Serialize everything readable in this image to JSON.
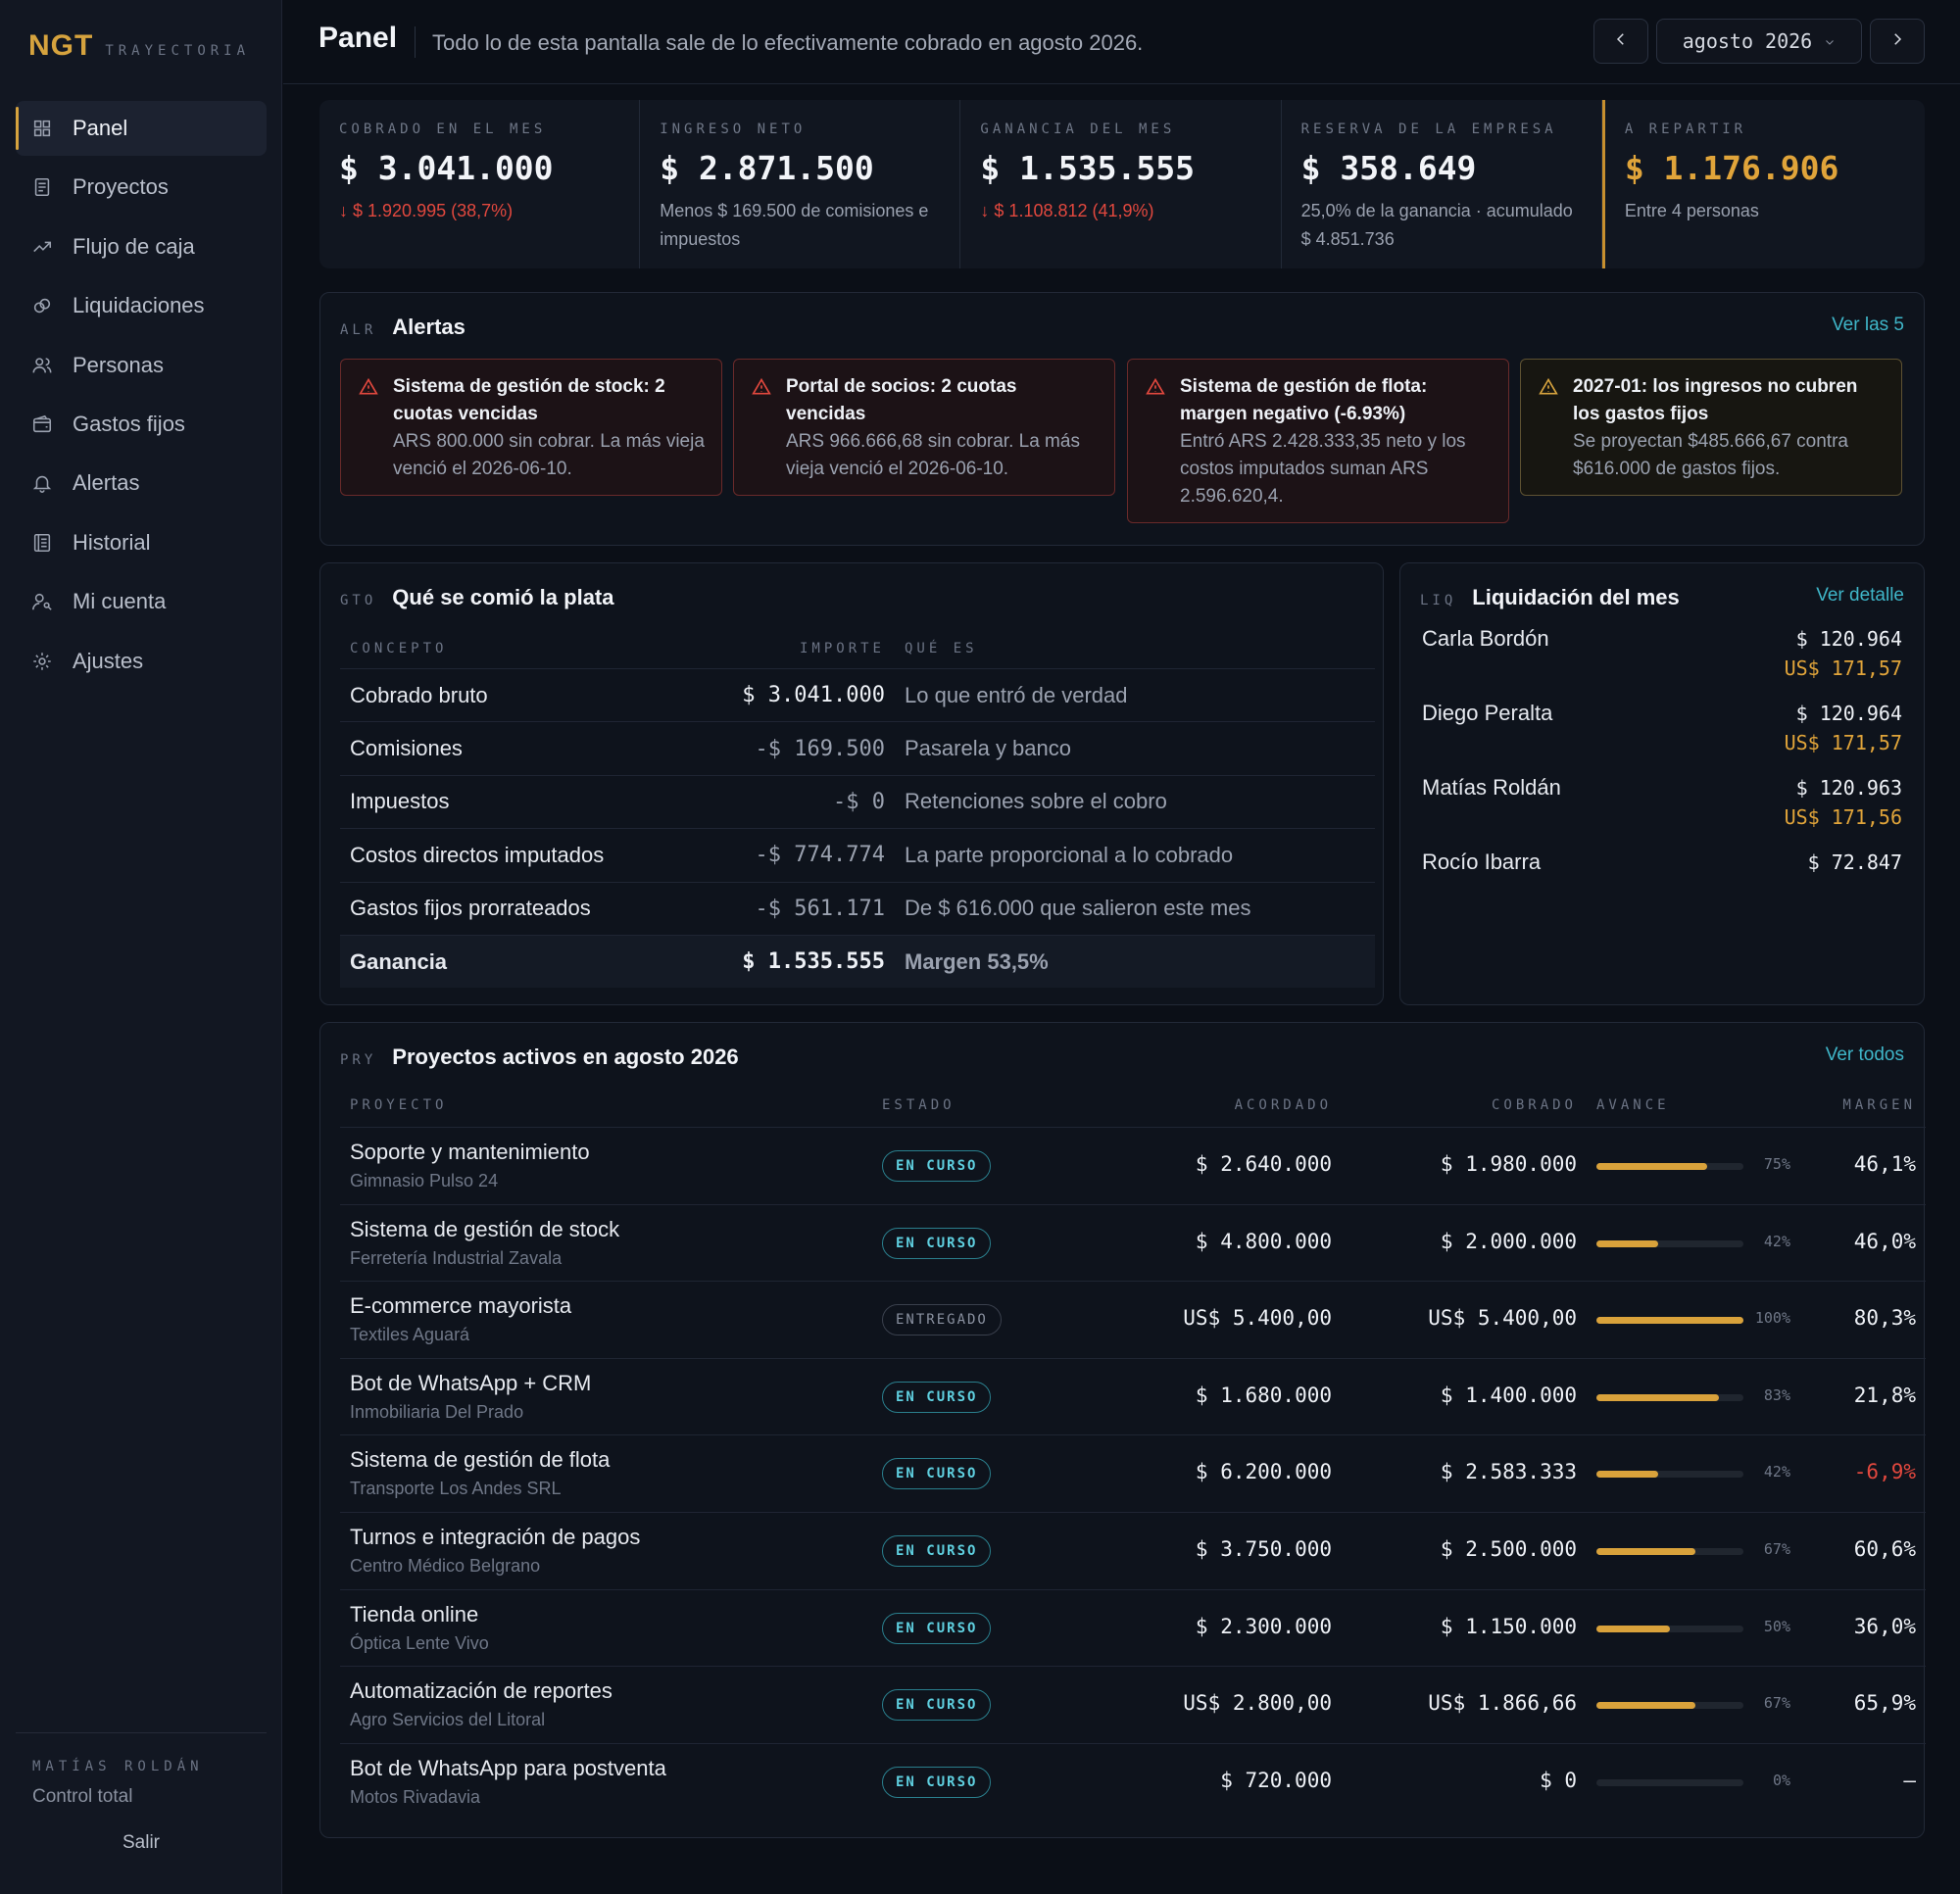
{
  "brand": {
    "logo": "NGT",
    "subtitle": "TRAYECTORIA"
  },
  "sidebar": {
    "items": [
      {
        "label": "Panel",
        "icon": "grid-icon",
        "active": true
      },
      {
        "label": "Proyectos",
        "icon": "document-icon"
      },
      {
        "label": "Flujo de caja",
        "icon": "trend-up-icon"
      },
      {
        "label": "Liquidaciones",
        "icon": "coins-icon"
      },
      {
        "label": "Personas",
        "icon": "users-icon"
      },
      {
        "label": "Gastos fijos",
        "icon": "wallet-icon"
      },
      {
        "label": "Alertas",
        "icon": "bell-icon"
      },
      {
        "label": "Historial",
        "icon": "ledger-icon"
      },
      {
        "label": "Mi cuenta",
        "icon": "user-key-icon"
      },
      {
        "label": "Ajustes",
        "icon": "gear-icon"
      }
    ],
    "user_name": "MATÍAS ROLDÁN",
    "user_role": "Control total",
    "logout": "Salir"
  },
  "header": {
    "title": "Panel",
    "subtitle": "Todo lo de esta pantalla sale de lo efectivamente cobrado en agosto 2026.",
    "month": "agosto 2026"
  },
  "kpis": [
    {
      "label": "COBRADO EN EL MES",
      "value": "$ 3.041.000",
      "note": "$ 1.920.995 (38,7%)",
      "note_type": "neg",
      "arrow": "↓"
    },
    {
      "label": "INGRESO NETO",
      "value": "$ 2.871.500",
      "note": "Menos $ 169.500 de comisiones e impuestos",
      "note_type": "muted"
    },
    {
      "label": "GANANCIA DEL MES",
      "value": "$ 1.535.555",
      "note": "$ 1.108.812 (41,9%)",
      "note_type": "neg",
      "arrow": "↓"
    },
    {
      "label": "RESERVA DE LA EMPRESA",
      "value": "$ 358.649",
      "note": "25,0% de la ganancia · acumulado $ 4.851.736",
      "note_type": "muted"
    },
    {
      "label": "A REPARTIR",
      "value": "$ 1.176.906",
      "note": "Entre 4 personas",
      "note_type": "muted",
      "highlight": true
    }
  ],
  "alerts": {
    "code": "ALR",
    "title": "Alertas",
    "link": "Ver las 5",
    "items": [
      {
        "title": "Sistema de gestión de stock: 2 cuotas vencidas",
        "body": "ARS 800.000 sin cobrar. La más vieja venció el 2026-06-10.",
        "level": "danger"
      },
      {
        "title": "Portal de socios: 2 cuotas vencidas",
        "body": "ARS 966.666,68 sin cobrar. La más vieja venció el 2026-06-10.",
        "level": "danger"
      },
      {
        "title": "Sistema de gestión de flota: margen negativo (-6.93%)",
        "body": "Entró ARS 2.428.333,35 neto y los costos imputados suman ARS 2.596.620,4.",
        "level": "danger"
      },
      {
        "title": "2027-01: los ingresos no cubren los gastos fijos",
        "body": "Se proyectan $485.666,67 contra $616.000 de gastos fijos.",
        "level": "warning"
      }
    ]
  },
  "gto": {
    "code": "GTO",
    "title": "Qué se comió la plata",
    "columns": {
      "concept": "CONCEPTO",
      "amount": "IMPORTE",
      "desc": "QUÉ ES"
    },
    "rows": [
      {
        "concept": "Cobrado bruto",
        "amount": "$ 3.041.000",
        "desc": "Lo que entró de verdad",
        "positive": true
      },
      {
        "concept": "Comisiones",
        "amount": "-$ 169.500",
        "desc": "Pasarela y banco"
      },
      {
        "concept": "Impuestos",
        "amount": "-$ 0",
        "desc": "Retenciones sobre el cobro"
      },
      {
        "concept": "Costos directos imputados",
        "amount": "-$ 774.774",
        "desc": "La parte proporcional a lo cobrado"
      },
      {
        "concept": "Gastos fijos prorrateados",
        "amount": "-$ 561.171",
        "desc": "De $ 616.000 que salieron este mes"
      },
      {
        "concept": "Ganancia",
        "amount": "$ 1.535.555",
        "desc": "Margen 53,5%",
        "positive": true,
        "total": true
      }
    ]
  },
  "liq": {
    "code": "LIQ",
    "title": "Liquidación del mes",
    "link": "Ver detalle",
    "rows": [
      {
        "name": "Carla Bordón",
        "ars": "$ 120.964",
        "usd": "US$ 171,57"
      },
      {
        "name": "Diego Peralta",
        "ars": "$ 120.964",
        "usd": "US$ 171,57"
      },
      {
        "name": "Matías Roldán",
        "ars": "$ 120.963",
        "usd": "US$ 171,56"
      },
      {
        "name": "Rocío Ibarra",
        "ars": "$ 72.847",
        "usd": ""
      }
    ]
  },
  "pry": {
    "code": "PRY",
    "title": "Proyectos activos en agosto 2026",
    "link": "Ver todos",
    "columns": {
      "project": "PROYECTO",
      "status": "ESTADO",
      "agreed": "ACORDADO",
      "paid": "COBRADO",
      "progress": "AVANCE",
      "margin": "MARGEN"
    },
    "rows": [
      {
        "name": "Soporte y mantenimiento",
        "client": "Gimnasio Pulso 24",
        "status": "EN CURSO",
        "agreed": "$ 2.640.000",
        "paid": "$ 1.980.000",
        "progress": 75,
        "progress_label": "75%",
        "margin": "46,1%"
      },
      {
        "name": "Sistema de gestión de stock",
        "client": "Ferretería Industrial Zavala",
        "status": "EN CURSO",
        "agreed": "$ 4.800.000",
        "paid": "$ 2.000.000",
        "progress": 42,
        "progress_label": "42%",
        "margin": "46,0%"
      },
      {
        "name": "E-commerce mayorista",
        "client": "Textiles Aguará",
        "status": "ENTREGADO",
        "agreed": "US$ 5.400,00",
        "paid": "US$ 5.400,00",
        "progress": 100,
        "progress_label": "100%",
        "margin": "80,3%"
      },
      {
        "name": "Bot de WhatsApp + CRM",
        "client": "Inmobiliaria Del Prado",
        "status": "EN CURSO",
        "agreed": "$ 1.680.000",
        "paid": "$ 1.400.000",
        "progress": 83,
        "progress_label": "83%",
        "margin": "21,8%"
      },
      {
        "name": "Sistema de gestión de flota",
        "client": "Transporte Los Andes SRL",
        "status": "EN CURSO",
        "agreed": "$ 6.200.000",
        "paid": "$ 2.583.333",
        "progress": 42,
        "progress_label": "42%",
        "margin": "-6,9%",
        "margin_negative": true
      },
      {
        "name": "Turnos e integración de pagos",
        "client": "Centro Médico Belgrano",
        "status": "EN CURSO",
        "agreed": "$ 3.750.000",
        "paid": "$ 2.500.000",
        "progress": 67,
        "progress_label": "67%",
        "margin": "60,6%"
      },
      {
        "name": "Tienda online",
        "client": "Óptica Lente Vivo",
        "status": "EN CURSO",
        "agreed": "$ 2.300.000",
        "paid": "$ 1.150.000",
        "progress": 50,
        "progress_label": "50%",
        "margin": "36,0%"
      },
      {
        "name": "Automatización de reportes",
        "client": "Agro Servicios del Litoral",
        "status": "EN CURSO",
        "agreed": "US$ 2.800,00",
        "paid": "US$ 1.866,66",
        "progress": 67,
        "progress_label": "67%",
        "margin": "65,9%"
      },
      {
        "name": "Bot de WhatsApp para postventa",
        "client": "Motos Rivadavia",
        "status": "EN CURSO",
        "agreed": "$ 720.000",
        "paid": "$ 0",
        "progress": 0,
        "progress_label": "0%",
        "margin": "—"
      }
    ]
  },
  "colors": {
    "accent": "#d6a33e",
    "link": "#3fb6c9",
    "negative": "#e2483e",
    "badge": "#5fd0e0"
  }
}
